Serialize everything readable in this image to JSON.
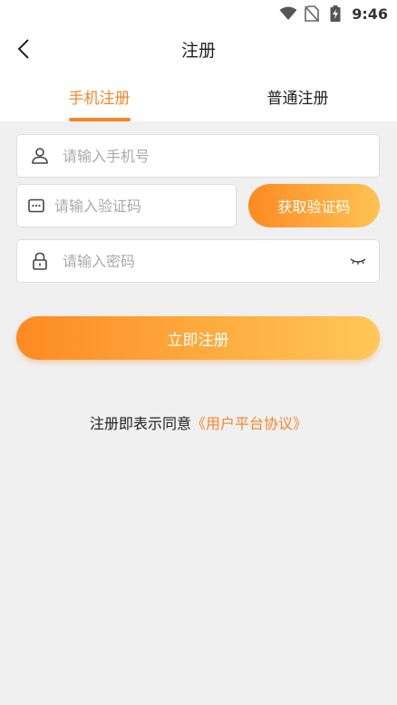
{
  "status_bar": {
    "time": "9:46",
    "icons": [
      "wifi-icon",
      "no-sim-icon",
      "battery-charging-icon"
    ]
  },
  "header": {
    "back_icon": "chevron-left-icon",
    "title": "注册"
  },
  "tabs": [
    {
      "label": "手机注册",
      "active": true
    },
    {
      "label": "普通注册",
      "active": false
    }
  ],
  "form": {
    "phone": {
      "placeholder": "请输入手机号",
      "value": "",
      "icon": "user-icon"
    },
    "code": {
      "placeholder": "请输入验证码",
      "value": "",
      "icon": "message-dots-icon"
    },
    "get_code_label": "获取验证码",
    "password": {
      "placeholder": "请输入密码",
      "value": "",
      "icon": "lock-icon",
      "toggle_icon": "eye-closed-icon"
    },
    "submit_label": "立即注册"
  },
  "agreement": {
    "prefix": "注册即表示同意",
    "link": "《用户平台协议》"
  },
  "colors": {
    "accent": "#f7862a",
    "gradient_start": "#fd8a23",
    "gradient_end": "#fec353",
    "background": "#f0f0f0"
  }
}
